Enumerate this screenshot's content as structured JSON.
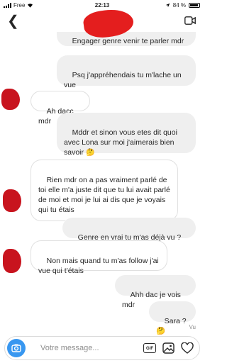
{
  "status_bar": {
    "carrier": "Free",
    "time": "22:13",
    "battery": "84 %",
    "battery_level": 0.84
  },
  "header": {
    "back_icon": "chevron-left-icon",
    "video_icon": "video-camera-icon"
  },
  "messages": [
    {
      "side": "out",
      "text": "Engager genre venir te parler mdr"
    },
    {
      "side": "out",
      "text": "Psq j'appréhendais tu m'lache un vue",
      "emoji": "🤷🏻‍♂️😭"
    },
    {
      "side": "in",
      "text": "Ah dacc mdr"
    },
    {
      "side": "out",
      "text": "Mddr et sinon vous etes dit quoi avec Lona sur moi j'aimerais bien savoir",
      "emoji": "🤔"
    },
    {
      "side": "in",
      "text": "Rien mdr on a pas vraiment parlé de toi elle m'a juste dit que tu lui avait parlé de moi et moi je lui ai dis que je voyais qui tu étais"
    },
    {
      "side": "out",
      "text": "Genre en vrai tu m'as déjà vu ? 🤔"
    },
    {
      "side": "in",
      "text": "Non mais quand tu m'as follow j'ai vue qui t'étais"
    },
    {
      "side": "out",
      "text": "Ahh dac je vois mdr"
    },
    {
      "side": "out",
      "text": "Sara ? 🤔"
    }
  ],
  "seen_label": "Vu",
  "composer": {
    "placeholder": "Votre message...",
    "gif_label": "GIF",
    "camera_icon": "camera-icon",
    "image_icon": "image-icon",
    "heart_icon": "heart-icon"
  }
}
